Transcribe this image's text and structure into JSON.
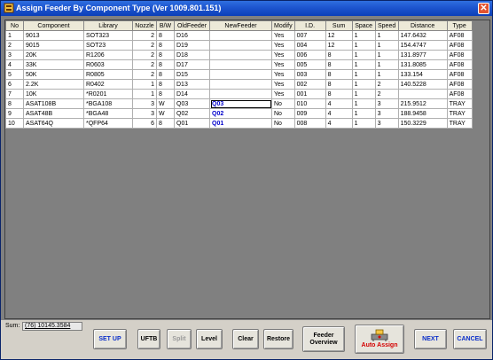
{
  "window": {
    "title": "Assign Feeder By Component Type (Ver 1009.801.151)",
    "close_glyph": "✕"
  },
  "table": {
    "columns": [
      "No",
      "Component",
      "Library",
      "Nozzle",
      "B/W",
      "OldFeeder",
      "NewFeeder",
      "Modify",
      "I.D.",
      "Sum",
      "Space",
      "Speed",
      "Distance",
      "Type"
    ],
    "rows": [
      [
        "1",
        "9013",
        "SOT323",
        "2",
        "8",
        "D16",
        "",
        "Yes",
        "007",
        "12",
        "1",
        "1",
        "147.6432",
        "AF08"
      ],
      [
        "2",
        "9015",
        "SOT23",
        "2",
        "8",
        "D19",
        "",
        "Yes",
        "004",
        "12",
        "1",
        "1",
        "154.4747",
        "AF08"
      ],
      [
        "3",
        "20K",
        "R1206",
        "2",
        "8",
        "D18",
        "",
        "Yes",
        "006",
        "8",
        "1",
        "1",
        "131.8977",
        "AF08"
      ],
      [
        "4",
        "33K",
        "R0603",
        "2",
        "8",
        "D17",
        "",
        "Yes",
        "005",
        "8",
        "1",
        "1",
        "131.8085",
        "AF08"
      ],
      [
        "5",
        "50K",
        "R0805",
        "2",
        "8",
        "D15",
        "",
        "Yes",
        "003",
        "8",
        "1",
        "1",
        "133.154",
        "AF08"
      ],
      [
        "6",
        "2.2K",
        "R0402",
        "1",
        "8",
        "D13",
        "",
        "Yes",
        "002",
        "8",
        "1",
        "2",
        "140.5228",
        "AF08"
      ],
      [
        "7",
        "10K",
        "*R0201",
        "1",
        "8",
        "D14",
        "",
        "Yes",
        "001",
        "8",
        "1",
        "2",
        "",
        "AF08"
      ],
      [
        "8",
        "ASAT108B",
        "*BGA108",
        "3",
        "W",
        "Q03",
        "Q03",
        "No",
        "010",
        "4",
        "1",
        "3",
        "215.9512",
        "TRAY"
      ],
      [
        "9",
        "ASAT48B",
        "*BGA48",
        "3",
        "W",
        "Q02",
        "Q02",
        "No",
        "009",
        "4",
        "1",
        "3",
        "188.9458",
        "TRAY"
      ],
      [
        "10",
        "ASAT64Q",
        "*QFP64",
        "6",
        "8",
        "Q01",
        "Q01",
        "No",
        "008",
        "4",
        "1",
        "3",
        "150.3229",
        "TRAY"
      ]
    ]
  },
  "footer": {
    "sum_label": "Sum:",
    "sum_value": "(76) 10145.3584"
  },
  "buttons": {
    "setup": "SET UP",
    "uftb": "UFTB",
    "split": "Split",
    "level": "Level",
    "clear": "Clear",
    "restore": "Restore",
    "feeder_overview": "Feeder Overview",
    "auto_assign": "Auto Assign",
    "next": "NEXT",
    "cancel": "CANCEL"
  },
  "colors": {
    "title_bar": "#1d55cf",
    "new_feeder_text": "#0000cc",
    "auto_assign_text": "#d40000",
    "primary_button_text": "#0a2ec9"
  },
  "icons": {
    "app": "app-icon",
    "auto_assign": "auto-assign-icon",
    "close": "close-icon"
  }
}
